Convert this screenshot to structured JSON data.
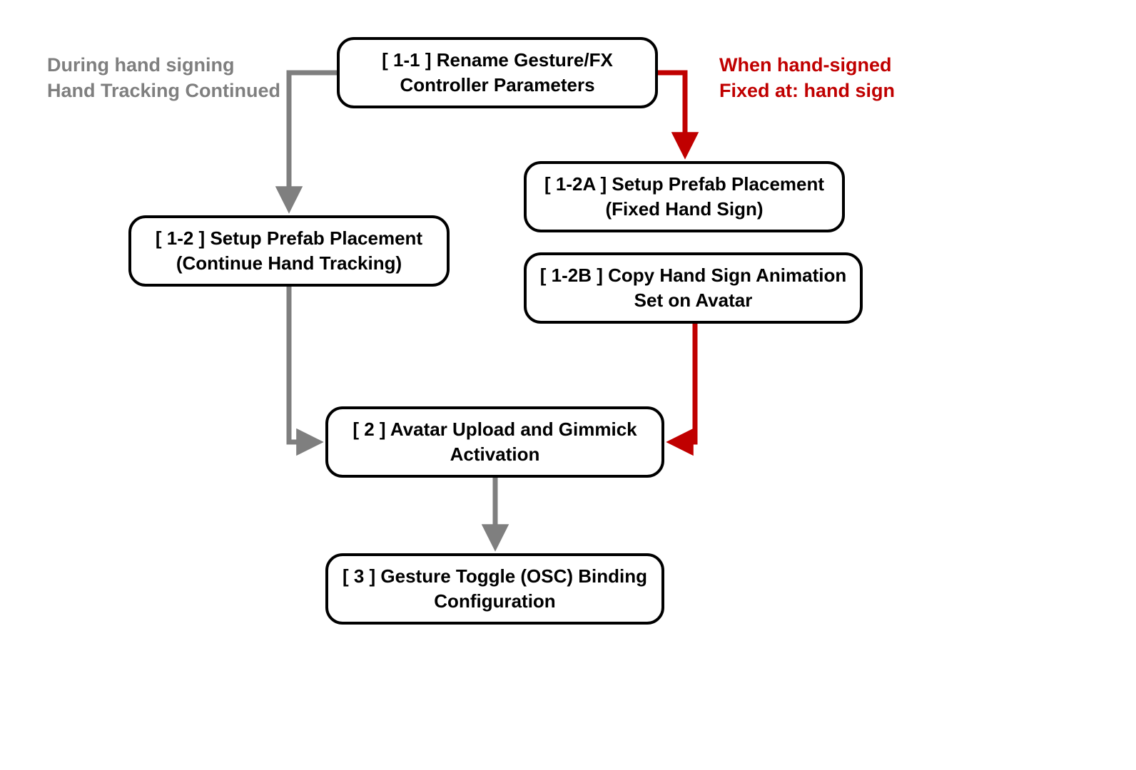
{
  "labels": {
    "left_grey_line1": "During hand signing",
    "left_grey_line2": "Hand Tracking Continued",
    "right_red_line1": "When hand-signed",
    "right_red_line2": "Fixed at: hand sign"
  },
  "nodes": {
    "n11_line1": "[ 1-1 ] Rename Gesture/FX",
    "n11_line2": "Controller Parameters",
    "n12_line1": "[ 1-2 ] Setup Prefab Placement",
    "n12_line2": "(Continue Hand Tracking)",
    "n12a_line1": "[ 1-2A ] Setup Prefab Placement",
    "n12a_line2": "(Fixed Hand Sign)",
    "n12b_line1": "[ 1-2B ] Copy Hand Sign Animation",
    "n12b_line2": "Set on Avatar",
    "n2_line1": "[ 2 ] Avatar Upload and Gimmick",
    "n2_line2": "Activation",
    "n3_line1": "[ 3 ] Gesture Toggle (OSC) Binding",
    "n3_line2": "Configuration"
  },
  "colors": {
    "grey": "#7f7f7f",
    "red": "#c00000",
    "black": "#000000"
  }
}
